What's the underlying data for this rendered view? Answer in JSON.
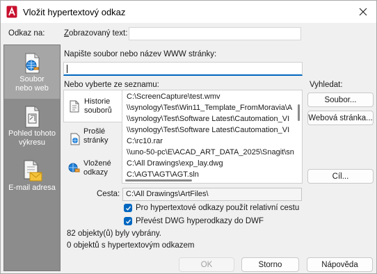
{
  "window": {
    "title": "Vložit hypertextový odkaz"
  },
  "link_to": {
    "heading": "Odkaz na:",
    "items": [
      {
        "label_line1": "Soubor",
        "label_line2": "nebo web",
        "icon": "globe-file-icon"
      },
      {
        "label_line1": "Pohled tohoto",
        "label_line2": "výkresu",
        "icon": "drawing-view-icon"
      },
      {
        "label_line1": "E-mail adresa",
        "label_line2": "",
        "icon": "email-icon"
      }
    ]
  },
  "display_text": {
    "label_prefix": "Z",
    "label_rest": "obrazovaný text:",
    "value": ""
  },
  "file_or_url": {
    "label_prefix": "Napište soubor nebo název WWW stránky:",
    "value": ""
  },
  "choose_from_list": {
    "label": "Nebo vyberte ze seznamu:"
  },
  "tabs": [
    {
      "line1": "Historie",
      "line2": "souborů",
      "icon": "history-icon"
    },
    {
      "line1": "Prošlé",
      "line2": "stránky",
      "icon": "browsed-pages-icon"
    },
    {
      "line1": "Vložené",
      "line2": "odkazy",
      "icon": "inserted-links-icon"
    }
  ],
  "file_list": [
    "C:\\ScreenCapture\\test.wmv",
    "\\\\synology\\Test\\Win11_Template_FromMoravia\\A",
    "\\\\synology\\Test\\Software Latest\\Cautomation_VI",
    "\\\\synology\\Test\\Software Latest\\Cautomation_VI",
    "C:\\rc10.rar",
    "\\\\uno-50-pc\\E\\ACAD_ART_DATA_2025\\Snagit\\sn",
    "C:\\All Drawings\\exp_lay.dwg",
    "C:\\AGT\\AGT\\AGT.sln"
  ],
  "browse": {
    "label": "Vyhledat:",
    "file_button": "Soubor...",
    "web_button": "Webová stránka...",
    "target_button": "Cíl..."
  },
  "path": {
    "label": "Cesta:",
    "value": "C:\\All Drawings\\ArtFiles\\"
  },
  "options": [
    {
      "label": "Pro hypertextové odkazy použít relativní cestu",
      "checked": true
    },
    {
      "label": "Převést DWG hyperodkazy do DWF",
      "checked": true
    }
  ],
  "status": {
    "selected": "82 objekty(ů) byly vybrány.",
    "with_links": "0 objektů s hypertextovým odkazem"
  },
  "buttons": {
    "ok": "OK",
    "cancel": "Storno",
    "help": "Nápověda"
  }
}
